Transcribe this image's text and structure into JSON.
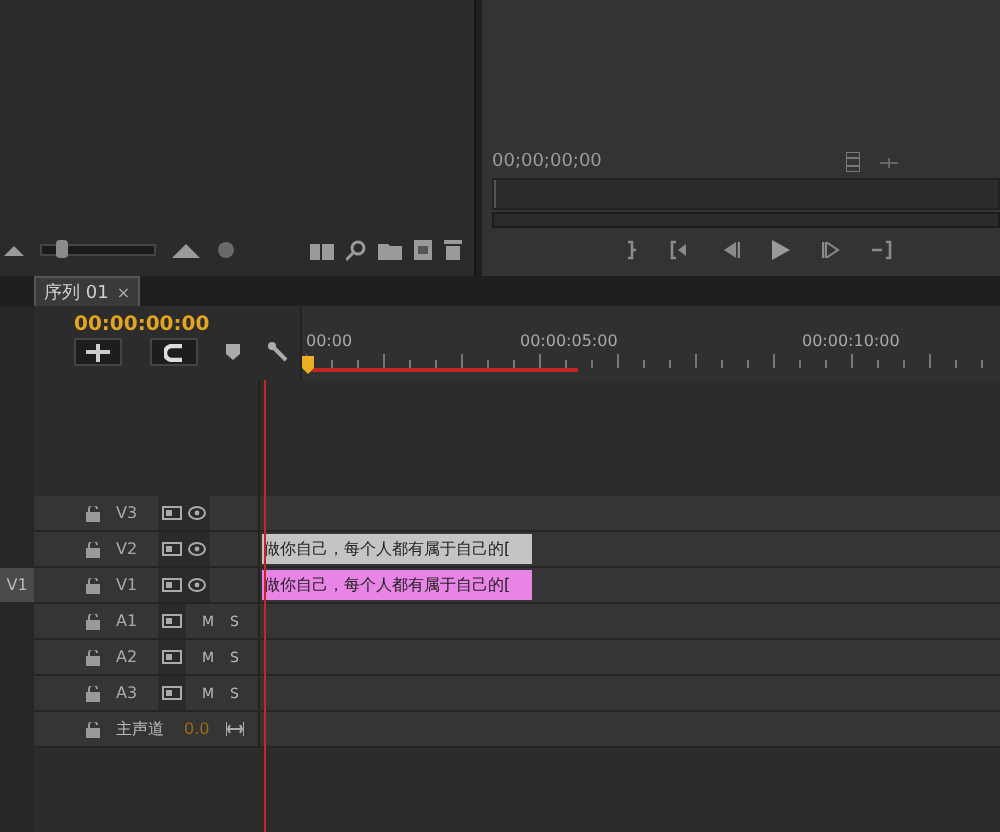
{
  "project_panel": {
    "zoom_slider": {
      "level": 0.12
    }
  },
  "program_monitor": {
    "timecode": "00;00;00;00",
    "playhead": {
      "level": 0.0
    }
  },
  "timeline": {
    "tab": {
      "label": "序列 01",
      "close": "×",
      "selected": true
    },
    "timecode": "00:00:00:00",
    "ruler": [
      "00:00",
      "00:00:05:00",
      "00:00:10:00"
    ],
    "tracks": [
      {
        "kind": "video",
        "name": "V3"
      },
      {
        "kind": "video",
        "name": "V2",
        "clip": {
          "text": "做你自己，每个人都有属于自己的[",
          "color": "#c4c4c4"
        }
      },
      {
        "kind": "video",
        "name": "V1",
        "source": "V1",
        "clip": {
          "text": "做你自己，每个人都有属于自己的[",
          "color": "#e884e6"
        }
      },
      {
        "kind": "audio",
        "name": "A1",
        "mute": "M",
        "solo": "S"
      },
      {
        "kind": "audio",
        "name": "A2",
        "mute": "M",
        "solo": "S"
      },
      {
        "kind": "audio",
        "name": "A3",
        "mute": "M",
        "solo": "S"
      },
      {
        "kind": "master",
        "name": "主声道",
        "value": "0.0"
      }
    ]
  }
}
